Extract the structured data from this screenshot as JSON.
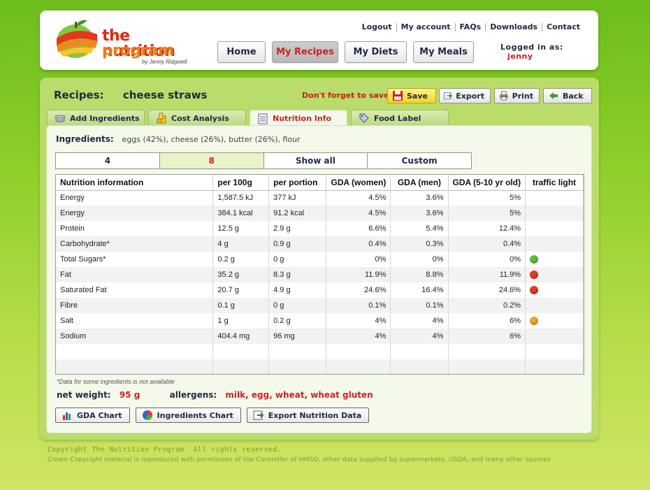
{
  "logo": {
    "line1": "the nutrition",
    "line2": "program",
    "byline": "by Jenny Ridgwell"
  },
  "top_links": [
    "Logout",
    "My account",
    "FAQs",
    "Downloads",
    "Contact"
  ],
  "nav": [
    {
      "label": "Home",
      "active": false
    },
    {
      "label": "My Recipes",
      "active": true
    },
    {
      "label": "My Diets",
      "active": false
    },
    {
      "label": "My Meals",
      "active": false
    }
  ],
  "user": {
    "logged_label": "Logged in as:",
    "name": "jenny"
  },
  "recipe": {
    "label": "Recipes:",
    "name": "cheese straws"
  },
  "actions": {
    "reminder": "Don't forget to save.",
    "save": "Save",
    "export": "Export",
    "print": "Print",
    "back": "Back"
  },
  "tabs": [
    {
      "label": "Add Ingredients",
      "icon": "pot-icon"
    },
    {
      "label": "Cost Analysis",
      "icon": "coins-icon"
    },
    {
      "label": "Nutrition Info",
      "icon": "document-icon",
      "active": true
    },
    {
      "label": "Food Label",
      "icon": "tag-icon"
    }
  ],
  "ingredients": {
    "label": "Ingredients:",
    "value": "eggs (42%), cheese (26%), butter (26%), flour"
  },
  "portions": [
    {
      "label": "4",
      "active": false
    },
    {
      "label": "8",
      "active": true
    },
    {
      "label": "Show all",
      "active": false
    },
    {
      "label": "Custom",
      "active": false
    }
  ],
  "table": {
    "headers": [
      "Nutrition information",
      "per 100g",
      "per portion",
      "GDA (women)",
      "GDA (men)",
      "GDA (5-10 yr old)",
      "traffic light"
    ],
    "rows": [
      [
        "Energy",
        "1,587.5 kJ",
        "377 kJ",
        "4.5%",
        "3.6%",
        "5%",
        ""
      ],
      [
        "Energy",
        "384.1 kcal",
        "91.2 kcal",
        "4.5%",
        "3.6%",
        "5%",
        ""
      ],
      [
        "Protein",
        "12.5 g",
        "2.9 g",
        "6.6%",
        "5.4%",
        "12.4%",
        ""
      ],
      [
        "Carbohydrate*",
        "4 g",
        "0.9 g",
        "0.4%",
        "0.3%",
        "0.4%",
        ""
      ],
      [
        "Total Sugars*",
        "0.2 g",
        "0 g",
        "0%",
        "0%",
        "0%",
        "green"
      ],
      [
        "Fat",
        "35.2 g",
        "8.3 g",
        "11.9%",
        "8.8%",
        "11.9%",
        "red"
      ],
      [
        "Saturated Fat",
        "20.7 g",
        "4.9 g",
        "24.6%",
        "16.4%",
        "24.6%",
        "red"
      ],
      [
        "Fibre",
        "0.1 g",
        "0 g",
        "0.1%",
        "0.1%",
        "0.2%",
        ""
      ],
      [
        "Salt",
        "1 g",
        "0.2 g",
        "4%",
        "4%",
        "6%",
        "amber"
      ],
      [
        "Sodium",
        "404.4 mg",
        "96 mg",
        "4%",
        "4%",
        "6%",
        ""
      ]
    ],
    "traffic_colors": {
      "green": "#5cbf3a",
      "red": "#e23a2a",
      "amber": "#f3a52a"
    }
  },
  "footnote": "*Data for some ingredients is not available",
  "summary": {
    "weight_label": "net weight:",
    "weight_value": "95 g",
    "allergens_label": "allergens:",
    "allergens_value": "milk, egg, wheat, wheat gluten"
  },
  "bottom_buttons": {
    "gda_chart": "GDA Chart",
    "ingredients_chart": "Ingredients Chart",
    "export_data": "Export Nutrition Data"
  },
  "footer": {
    "copyright": "Copyright The Nutrition Program. All rights reserved.",
    "crown": "Crown Copyright material is reproduced with permission of the Controller of HMSO, other data supplied by supermarkets, USDA, and many other sources"
  }
}
